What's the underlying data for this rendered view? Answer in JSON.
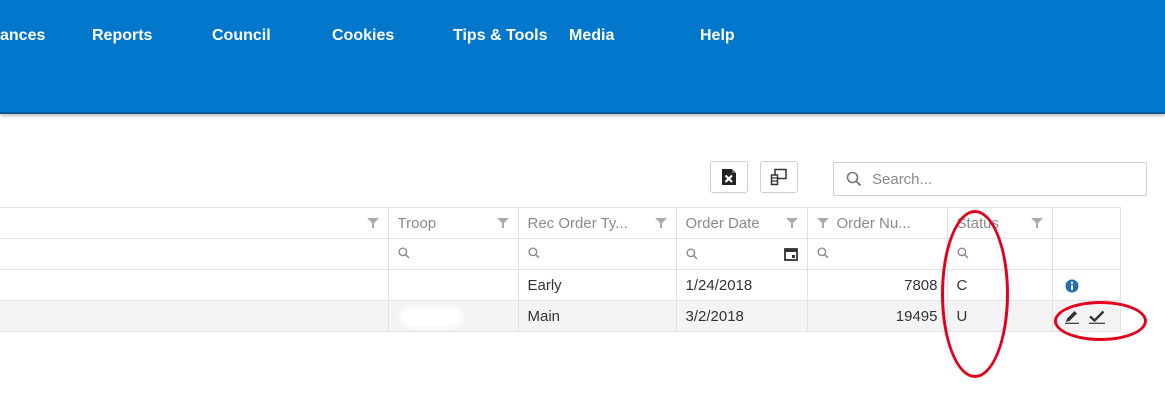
{
  "nav": {
    "items": [
      "ances",
      "Reports",
      "Council",
      "Cookies",
      "Tips & Tools",
      "Media",
      "Help"
    ]
  },
  "toolbar": {
    "export_excel_icon": "excel-export-icon",
    "column_chooser_icon": "column-chooser-icon",
    "search_placeholder": "Search..."
  },
  "table": {
    "columns": [
      "Troop",
      "Rec Order Ty...",
      "Order Date",
      "Order Nu...",
      "Status"
    ],
    "rows": [
      {
        "troop": "",
        "rec_order_type": "Early",
        "order_date": "1/24/2018",
        "order_number": "7808",
        "status": "C",
        "action": "info-icon"
      },
      {
        "troop": "",
        "rec_order_type": "Main",
        "order_date": "3/2/2018",
        "order_number": "19495",
        "status": "U",
        "action": "edit-approve-icons"
      }
    ]
  },
  "colors": {
    "header_blue": "#0277cc",
    "annotation_red": "#e3001b",
    "info_blue": "#1f6fb2"
  }
}
